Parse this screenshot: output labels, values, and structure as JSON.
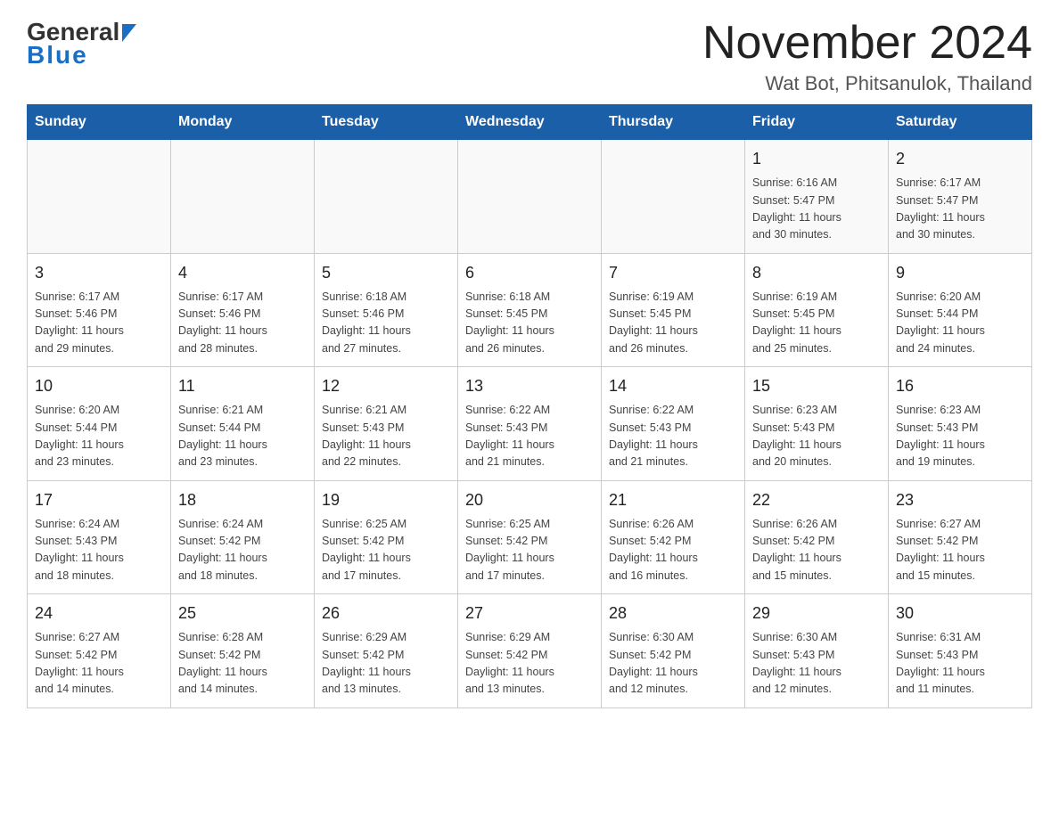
{
  "logo": {
    "general": "General",
    "blue": "Blue"
  },
  "title": "November 2024",
  "subtitle": "Wat Bot, Phitsanulok, Thailand",
  "days": [
    "Sunday",
    "Monday",
    "Tuesday",
    "Wednesday",
    "Thursday",
    "Friday",
    "Saturday"
  ],
  "weeks": [
    [
      {
        "day": "",
        "info": ""
      },
      {
        "day": "",
        "info": ""
      },
      {
        "day": "",
        "info": ""
      },
      {
        "day": "",
        "info": ""
      },
      {
        "day": "",
        "info": ""
      },
      {
        "day": "1",
        "info": "Sunrise: 6:16 AM\nSunset: 5:47 PM\nDaylight: 11 hours\nand 30 minutes."
      },
      {
        "day": "2",
        "info": "Sunrise: 6:17 AM\nSunset: 5:47 PM\nDaylight: 11 hours\nand 30 minutes."
      }
    ],
    [
      {
        "day": "3",
        "info": "Sunrise: 6:17 AM\nSunset: 5:46 PM\nDaylight: 11 hours\nand 29 minutes."
      },
      {
        "day": "4",
        "info": "Sunrise: 6:17 AM\nSunset: 5:46 PM\nDaylight: 11 hours\nand 28 minutes."
      },
      {
        "day": "5",
        "info": "Sunrise: 6:18 AM\nSunset: 5:46 PM\nDaylight: 11 hours\nand 27 minutes."
      },
      {
        "day": "6",
        "info": "Sunrise: 6:18 AM\nSunset: 5:45 PM\nDaylight: 11 hours\nand 26 minutes."
      },
      {
        "day": "7",
        "info": "Sunrise: 6:19 AM\nSunset: 5:45 PM\nDaylight: 11 hours\nand 26 minutes."
      },
      {
        "day": "8",
        "info": "Sunrise: 6:19 AM\nSunset: 5:45 PM\nDaylight: 11 hours\nand 25 minutes."
      },
      {
        "day": "9",
        "info": "Sunrise: 6:20 AM\nSunset: 5:44 PM\nDaylight: 11 hours\nand 24 minutes."
      }
    ],
    [
      {
        "day": "10",
        "info": "Sunrise: 6:20 AM\nSunset: 5:44 PM\nDaylight: 11 hours\nand 23 minutes."
      },
      {
        "day": "11",
        "info": "Sunrise: 6:21 AM\nSunset: 5:44 PM\nDaylight: 11 hours\nand 23 minutes."
      },
      {
        "day": "12",
        "info": "Sunrise: 6:21 AM\nSunset: 5:43 PM\nDaylight: 11 hours\nand 22 minutes."
      },
      {
        "day": "13",
        "info": "Sunrise: 6:22 AM\nSunset: 5:43 PM\nDaylight: 11 hours\nand 21 minutes."
      },
      {
        "day": "14",
        "info": "Sunrise: 6:22 AM\nSunset: 5:43 PM\nDaylight: 11 hours\nand 21 minutes."
      },
      {
        "day": "15",
        "info": "Sunrise: 6:23 AM\nSunset: 5:43 PM\nDaylight: 11 hours\nand 20 minutes."
      },
      {
        "day": "16",
        "info": "Sunrise: 6:23 AM\nSunset: 5:43 PM\nDaylight: 11 hours\nand 19 minutes."
      }
    ],
    [
      {
        "day": "17",
        "info": "Sunrise: 6:24 AM\nSunset: 5:43 PM\nDaylight: 11 hours\nand 18 minutes."
      },
      {
        "day": "18",
        "info": "Sunrise: 6:24 AM\nSunset: 5:42 PM\nDaylight: 11 hours\nand 18 minutes."
      },
      {
        "day": "19",
        "info": "Sunrise: 6:25 AM\nSunset: 5:42 PM\nDaylight: 11 hours\nand 17 minutes."
      },
      {
        "day": "20",
        "info": "Sunrise: 6:25 AM\nSunset: 5:42 PM\nDaylight: 11 hours\nand 17 minutes."
      },
      {
        "day": "21",
        "info": "Sunrise: 6:26 AM\nSunset: 5:42 PM\nDaylight: 11 hours\nand 16 minutes."
      },
      {
        "day": "22",
        "info": "Sunrise: 6:26 AM\nSunset: 5:42 PM\nDaylight: 11 hours\nand 15 minutes."
      },
      {
        "day": "23",
        "info": "Sunrise: 6:27 AM\nSunset: 5:42 PM\nDaylight: 11 hours\nand 15 minutes."
      }
    ],
    [
      {
        "day": "24",
        "info": "Sunrise: 6:27 AM\nSunset: 5:42 PM\nDaylight: 11 hours\nand 14 minutes."
      },
      {
        "day": "25",
        "info": "Sunrise: 6:28 AM\nSunset: 5:42 PM\nDaylight: 11 hours\nand 14 minutes."
      },
      {
        "day": "26",
        "info": "Sunrise: 6:29 AM\nSunset: 5:42 PM\nDaylight: 11 hours\nand 13 minutes."
      },
      {
        "day": "27",
        "info": "Sunrise: 6:29 AM\nSunset: 5:42 PM\nDaylight: 11 hours\nand 13 minutes."
      },
      {
        "day": "28",
        "info": "Sunrise: 6:30 AM\nSunset: 5:42 PM\nDaylight: 11 hours\nand 12 minutes."
      },
      {
        "day": "29",
        "info": "Sunrise: 6:30 AM\nSunset: 5:43 PM\nDaylight: 11 hours\nand 12 minutes."
      },
      {
        "day": "30",
        "info": "Sunrise: 6:31 AM\nSunset: 5:43 PM\nDaylight: 11 hours\nand 11 minutes."
      }
    ]
  ]
}
